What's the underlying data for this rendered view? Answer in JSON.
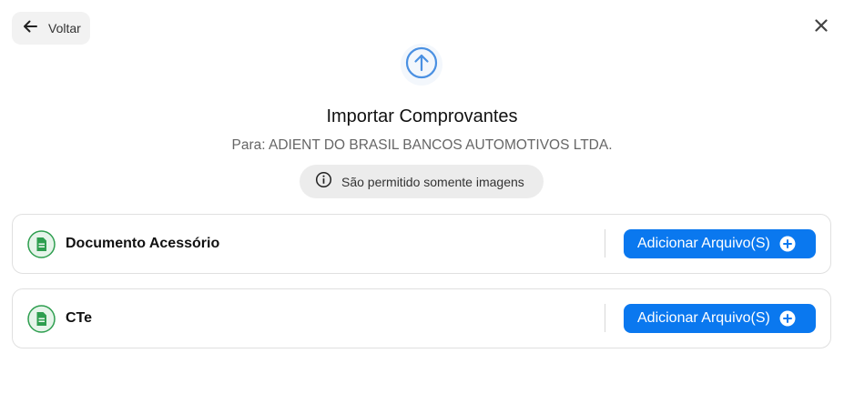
{
  "header": {
    "back_label": "Voltar"
  },
  "dialog": {
    "title": "Importar Comprovantes",
    "subtitle": "Para: ADIENT DO BRASIL BANCOS AUTOMOTIVOS LTDA.",
    "info_text": "São permitido somente imagens"
  },
  "documents": [
    {
      "name": "Documento Acessório",
      "button_label": "Adicionar Arquivo(S)"
    },
    {
      "name": "CTe",
      "button_label": "Adicionar Arquivo(S)"
    }
  ],
  "colors": {
    "accent": "#0a78ef",
    "doc_icon": "#2e9e4f",
    "upload_icon": "#4a90e2"
  },
  "icons": {
    "back": "arrow-left-icon",
    "close": "close-icon",
    "upload": "arrow-up-circle-icon",
    "info": "info-icon",
    "document": "document-icon",
    "add": "plus-circle-icon"
  }
}
